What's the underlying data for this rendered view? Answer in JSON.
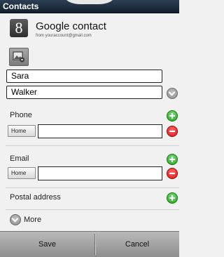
{
  "window": {
    "title": "Contacts"
  },
  "account": {
    "logo_letter": "8",
    "name": "Google contact",
    "email": "from youraccount@gmail.com"
  },
  "contact": {
    "first_name": "Sara",
    "last_name": "Walker"
  },
  "phone": {
    "label": "Phone",
    "type": "Home",
    "value": ""
  },
  "email": {
    "label": "Email",
    "type": "Home",
    "value": ""
  },
  "postal": {
    "label": "Postal address"
  },
  "more": {
    "label": "More"
  },
  "actions": {
    "save": "Save",
    "cancel": "Cancel"
  },
  "colors": {
    "add": "#2aa52a",
    "remove": "#d11616",
    "titlebar": "#1b2a3c"
  }
}
